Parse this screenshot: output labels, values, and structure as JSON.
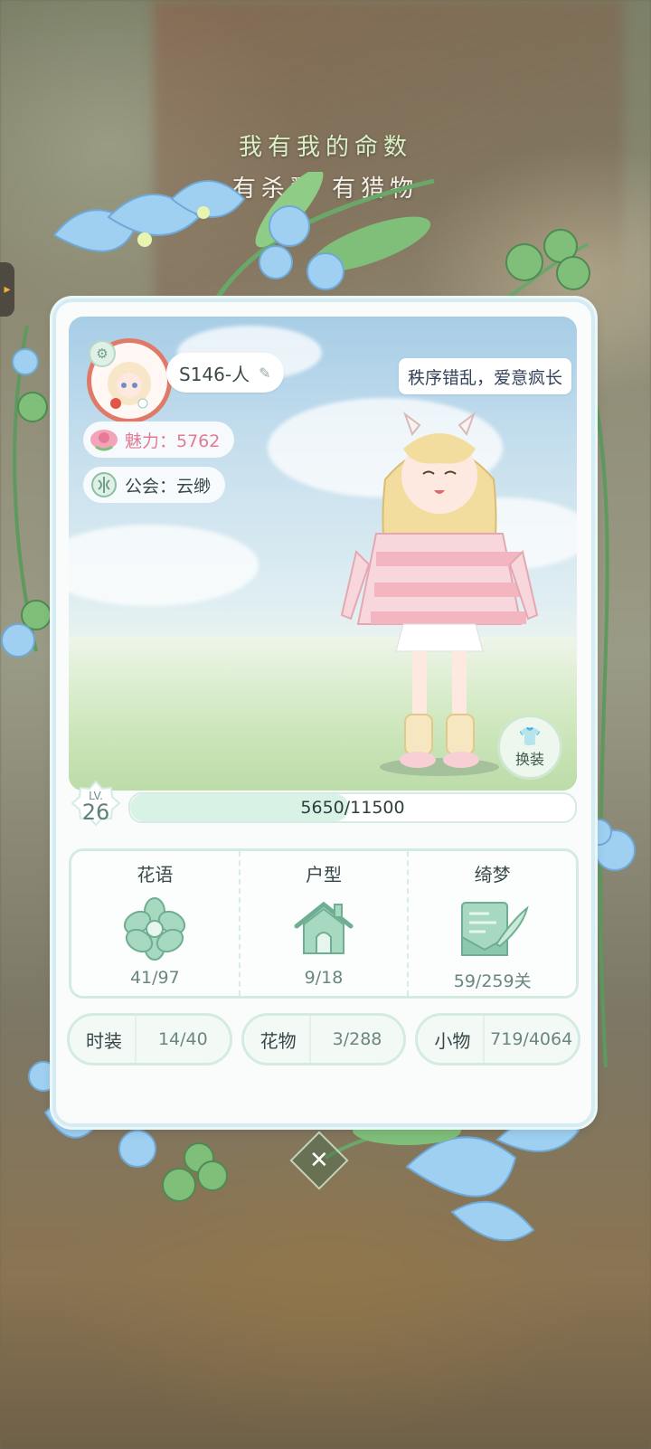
{
  "poem": {
    "line1": "我有我的命数",
    "line2": "有杀戮 有猎物"
  },
  "profile": {
    "name": "S146-人",
    "charm_label": "魅力：5762",
    "guild_label": "公会：云缈",
    "speech": "秩序错乱，爱意疯长"
  },
  "dress_button": "换装",
  "level": {
    "label": "LV.",
    "value": "26"
  },
  "exp": {
    "text": "5650/11500",
    "current": 5650,
    "max": 11500
  },
  "collections": [
    {
      "title": "花语",
      "count": "41/97",
      "icon": "flower-icon"
    },
    {
      "title": "户型",
      "count": "9/18",
      "icon": "house-icon"
    },
    {
      "title": "绮梦",
      "count": "59/259关",
      "icon": "letter-icon"
    }
  ],
  "small_stats": [
    {
      "label": "时装",
      "value": "14/40"
    },
    {
      "label": "花物",
      "value": "3/288"
    },
    {
      "label": "小物",
      "value": "719/4064"
    }
  ],
  "colors": {
    "accent": "#d4ecdf",
    "charm": "#e07b94",
    "card": "#f9fcfb"
  }
}
